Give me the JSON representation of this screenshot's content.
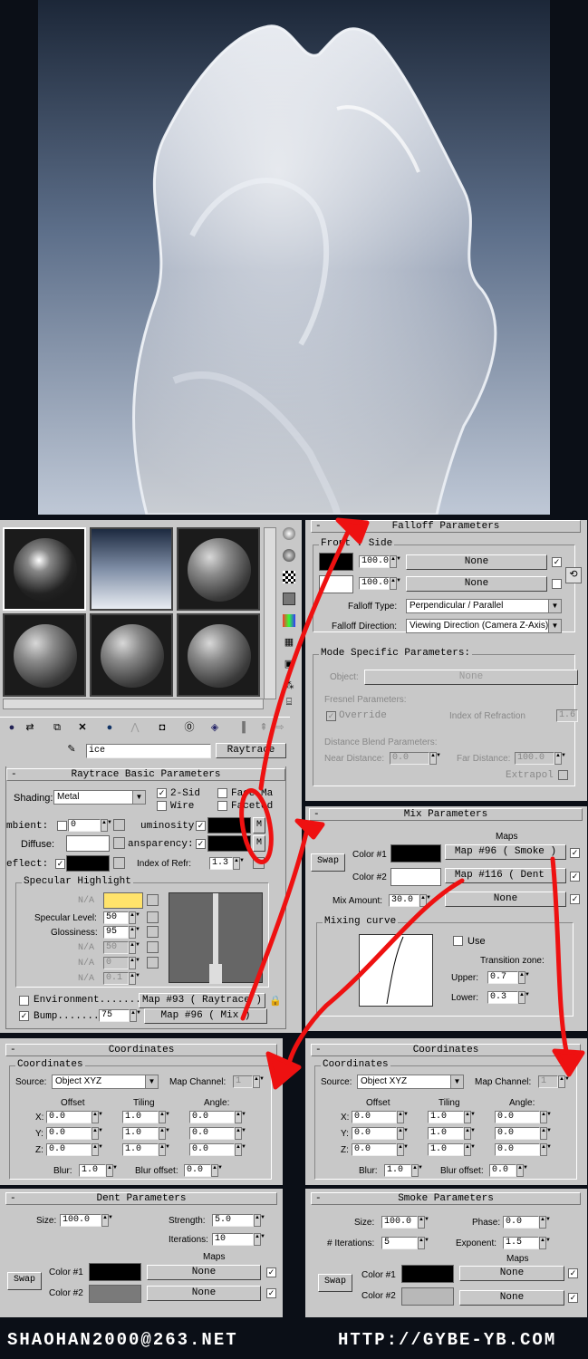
{
  "falloff": {
    "title": "Falloff Parameters",
    "front_side_label": "Front : Side",
    "amount1": "100.0",
    "amount2": "100.0",
    "map1": "None",
    "map2": "None",
    "falloff_type_label": "Falloff Type:",
    "falloff_type": "Perpendicular / Parallel",
    "falloff_direction_label": "Falloff Direction:",
    "falloff_direction": "Viewing Direction (Camera Z-Axis)",
    "mode_specific_label": "Mode Specific Parameters:",
    "object_label": "Object:",
    "object_value": "None",
    "fresnel_label": "Fresnel Parameters:",
    "override_label": "Override",
    "ior_label": "Index of Refraction",
    "ior_value": "1.6",
    "distance_blend_label": "Distance Blend Parameters:",
    "near_label": "Near Distance:",
    "near_value": "0.0",
    "far_label": "Far Distance:",
    "far_value": "100.0",
    "extrapolate_label": "Extrapol"
  },
  "editor": {
    "material_name": "ice",
    "material_type": "Raytrace"
  },
  "raytrace": {
    "title": "Raytrace Basic Parameters",
    "shading_label": "Shading:",
    "shading_value": "Metal",
    "two_sided": "2-Sid",
    "wire": "Wire",
    "face_map": "Face Ma",
    "faceted": "Faceted",
    "ambient_label": "mbient:",
    "ambient_value": "0",
    "luminosity_label": "uminosity:",
    "diffuse_label": "Diffuse:",
    "transparency_label": "ansparency:",
    "reflect_label": "eflect:",
    "ior_label": "Index of Refr:",
    "ior_value": "1.3",
    "m_label": "M",
    "specular_title": "Specular Highlight",
    "na": "N/A",
    "spec_level_label": "Specular Level:",
    "spec_level": "50",
    "glossiness_label": "Glossiness:",
    "glossiness": "95",
    "na_val1": "50",
    "na_val2": "0",
    "na_val3": "0.1",
    "environment_label": "Environment.......",
    "environment_map": "Map #93  ( Raytrace )",
    "bump_label": "Bump.......",
    "bump_value": "75",
    "bump_map": "Map #96  ( Mix )"
  },
  "mix": {
    "title": "Mix Parameters",
    "maps_label": "Maps",
    "swap_label": "Swap",
    "color1_label": "Color #1",
    "color2_label": "Color #2",
    "map1": "Map #96  ( Smoke )",
    "map2": "Map #116  ( Dent )",
    "mix_amount_label": "Mix Amount:",
    "mix_amount": "30.0",
    "mix_map": "None",
    "mixing_curve_label": "Mixing curve",
    "use_label": "Use",
    "transition_label": "Transition zone:",
    "upper_label": "Upper:",
    "upper_value": "0.7",
    "lower_label": "Lower:",
    "lower_value": "0.3"
  },
  "coords_left": {
    "title": "Coordinates",
    "group": "Coordinates",
    "source_label": "Source:",
    "source": "Object XYZ",
    "map_channel_label": "Map Channel:",
    "map_channel": "1",
    "offset_label": "Offset",
    "tiling_label": "Tiling",
    "angle_label": "Angle:",
    "x": "X:",
    "y": "Y:",
    "z": "Z:",
    "ox": "0.0",
    "oy": "0.0",
    "oz": "0.0",
    "tx": "1.0",
    "ty": "1.0",
    "tz": "1.0",
    "ax": "0.0",
    "ay": "0.0",
    "az": "0.0",
    "blur_label": "Blur:",
    "blur": "1.0",
    "blur_offset_label": "Blur offset:",
    "blur_offset": "0.0"
  },
  "coords_right": {
    "title": "Coordinates",
    "group": "Coordinates",
    "source_label": "Source:",
    "source": "Object XYZ",
    "map_channel_label": "Map Channel:",
    "map_channel": "1",
    "offset_label": "Offset",
    "tiling_label": "Tiling",
    "angle_label": "Angle:",
    "x": "X:",
    "y": "Y:",
    "z": "Z:",
    "ox": "0.0",
    "oy": "0.0",
    "oz": "0.0",
    "tx": "1.0",
    "ty": "1.0",
    "tz": "1.0",
    "ax": "0.0",
    "ay": "0.0",
    "az": "0.0",
    "blur_label": "Blur:",
    "blur": "1.0",
    "blur_offset_label": "Blur offset:",
    "blur_offset": "0.0"
  },
  "dent": {
    "title": "Dent Parameters",
    "size_label": "Size:",
    "size": "100.0",
    "strength_label": "Strength:",
    "strength": "5.0",
    "iterations_label": "Iterations:",
    "iterations": "10",
    "maps_label": "Maps",
    "swap_label": "Swap",
    "color1_label": "Color #1",
    "color2_label": "Color #2",
    "map1": "None",
    "map2": "None"
  },
  "smoke": {
    "title": "Smoke Parameters",
    "size_label": "Size:",
    "size": "100.0",
    "phase_label": "Phase:",
    "phase": "0.0",
    "iterations_label": "# Iterations:",
    "iterations": "5",
    "exponent_label": "Exponent:",
    "exponent": "1.5",
    "maps_label": "Maps",
    "swap_label": "Swap",
    "color1_label": "Color #1",
    "color2_label": "Color #2",
    "map1": "None",
    "map2": "None"
  },
  "footer": {
    "email": "SHAOHAN2000@263.NET",
    "url": "HTTP://GYBE-YB.COM"
  },
  "colors": {
    "ui_gray": "#c8c8c8",
    "annotation_red": "#ee1111",
    "specular_yellow": "#ffe36b"
  },
  "icons": [
    "sphere-icon",
    "checker-icon",
    "cube-icon",
    "swatch-icon",
    "close-icon",
    "pipette-icon",
    "lock-icon",
    "rotate-icon"
  ]
}
